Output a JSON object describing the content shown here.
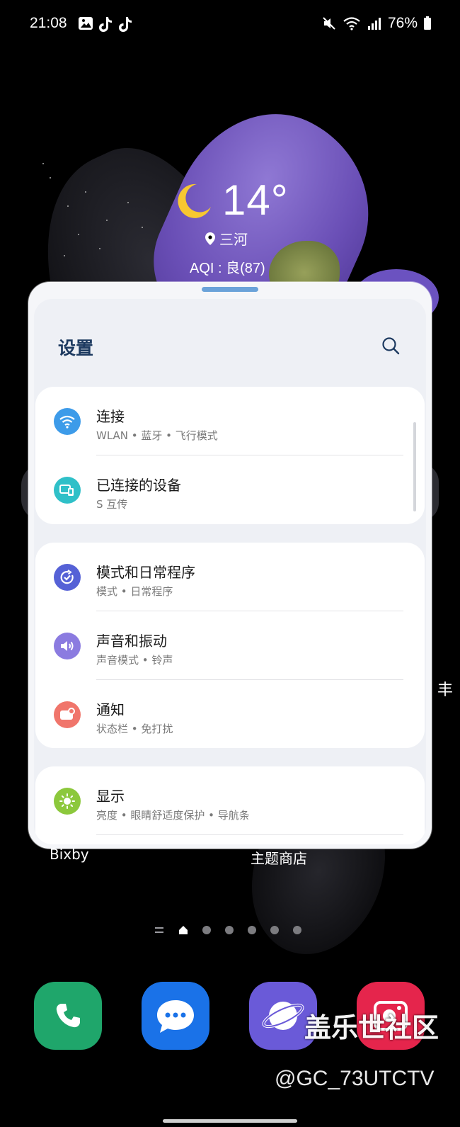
{
  "status_bar": {
    "time": "21:08",
    "battery": "76%"
  },
  "weather": {
    "temperature": "14°",
    "location": "三河",
    "aqi": "AQI : 良(87)"
  },
  "settings_panel": {
    "title": "设置",
    "groups": [
      {
        "items": [
          {
            "title": "连接",
            "subtitle": "WLAN • 蓝牙 • 飞行模式",
            "icon": "wifi-icon",
            "color": "#3d9be9"
          },
          {
            "title": "已连接的设备",
            "subtitle": "S 互传",
            "icon": "devices-icon",
            "color": "#2fc0c8"
          }
        ]
      },
      {
        "items": [
          {
            "title": "模式和日常程序",
            "subtitle": "模式 • 日常程序",
            "icon": "routine-icon",
            "color": "#5561d6"
          },
          {
            "title": "声音和振动",
            "subtitle": "声音模式 • 铃声",
            "icon": "volume-icon",
            "color": "#8b7be0"
          },
          {
            "title": "通知",
            "subtitle": "状态栏 • 免打扰",
            "icon": "notification-icon",
            "color": "#f0756b"
          }
        ]
      },
      {
        "items": [
          {
            "title": "显示",
            "subtitle": "亮度 • 眼睛舒适度保护 • 导航条",
            "icon": "brightness-icon",
            "color": "#8cc83c"
          }
        ]
      }
    ]
  },
  "home": {
    "label_left": "Bixby",
    "label_right": "主题商店",
    "edge_char": "丰"
  },
  "dock": [
    {
      "name": "phone-app",
      "color": "#1fa66b"
    },
    {
      "name": "messages-app",
      "color": "#1a72e8"
    },
    {
      "name": "internet-app",
      "color": "#6a5ad8"
    },
    {
      "name": "camera-app",
      "color": "#e5254c"
    }
  ],
  "watermark": {
    "text": "盖乐世社区",
    "handle": "@GC_73UTCTV"
  }
}
